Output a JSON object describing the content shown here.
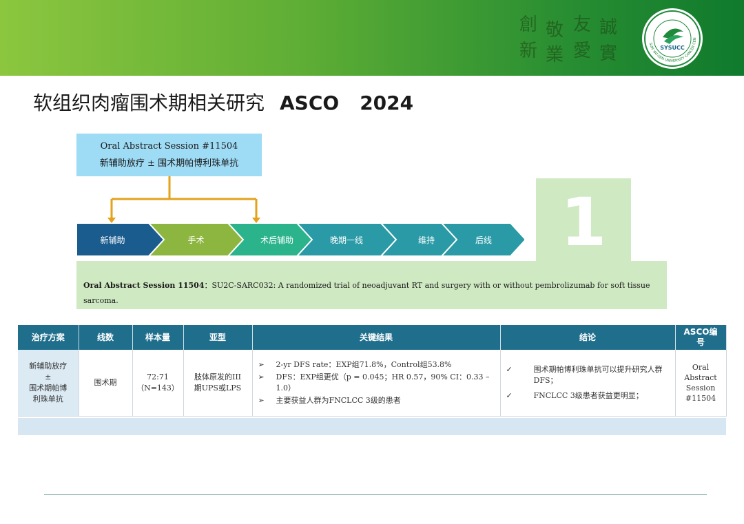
{
  "header": {
    "calligraphy": [
      "創",
      "新",
      "敬",
      "業",
      "友",
      "愛",
      "誠",
      "實"
    ],
    "logo": {
      "text": "SYSUCC",
      "ring_text": "SUN YAT-SEN UNIVERSITY CANCER CENTER"
    }
  },
  "title": {
    "cn": "软组织肉瘤围术期相关研究",
    "conf": "ASCO",
    "year": "2024"
  },
  "callout": {
    "line1": "Oral Abstract Session #11504",
    "line2": "新辅助放疗 ± 围术期帕博利珠单抗"
  },
  "flow": {
    "steps": [
      {
        "label": "新辅助",
        "color": "#1b5c8f"
      },
      {
        "label": "手术",
        "color": "#8db640"
      },
      {
        "label": "术后辅助",
        "color": "#2bb38c"
      },
      {
        "label": "晚期一线",
        "color": "#2a9aa6"
      },
      {
        "label": "维持",
        "color": "#2a9aa6"
      },
      {
        "label": "后线",
        "color": "#2a9aa6"
      }
    ],
    "connector_color": "#e3a21a"
  },
  "badge": {
    "number": "1"
  },
  "summary": {
    "bold": "Oral Abstract Session 11504",
    "sep": "：",
    "text": "SU2C-SARC032: A randomized trial of neoadjuvant RT and surgery with or without pembrolizumab for soft tissue sarcoma."
  },
  "table": {
    "headers": [
      "治疗方案",
      "线数",
      "样本量",
      "亚型",
      "关键结果",
      "结论",
      "ASCO编号"
    ],
    "row": {
      "regimen": [
        "新辅助放疗",
        "±",
        "围术期帕博",
        "利珠单抗"
      ],
      "line": "围术期",
      "sample": [
        "72:71",
        "（N=143）"
      ],
      "subtype": [
        "肢体原发的III",
        "期UPS或LPS"
      ],
      "results": [
        "2-yr DFS rate：EXP组71.8%，Control组53.8%",
        "DFS：EXP组更优（p = 0.045；HR 0.57，90% CI：0.33 – 1.0）",
        "主要获益人群为FNCLCC 3级的患者"
      ],
      "conclusions": [
        "围术期帕博利珠单抗可以提升研究人群DFS；",
        "FNCLCC 3级患者获益更明显；"
      ],
      "asco_id": [
        "Oral",
        "Abstract",
        "Session",
        "#11504"
      ]
    },
    "bullet": "➢",
    "check": "✓"
  }
}
